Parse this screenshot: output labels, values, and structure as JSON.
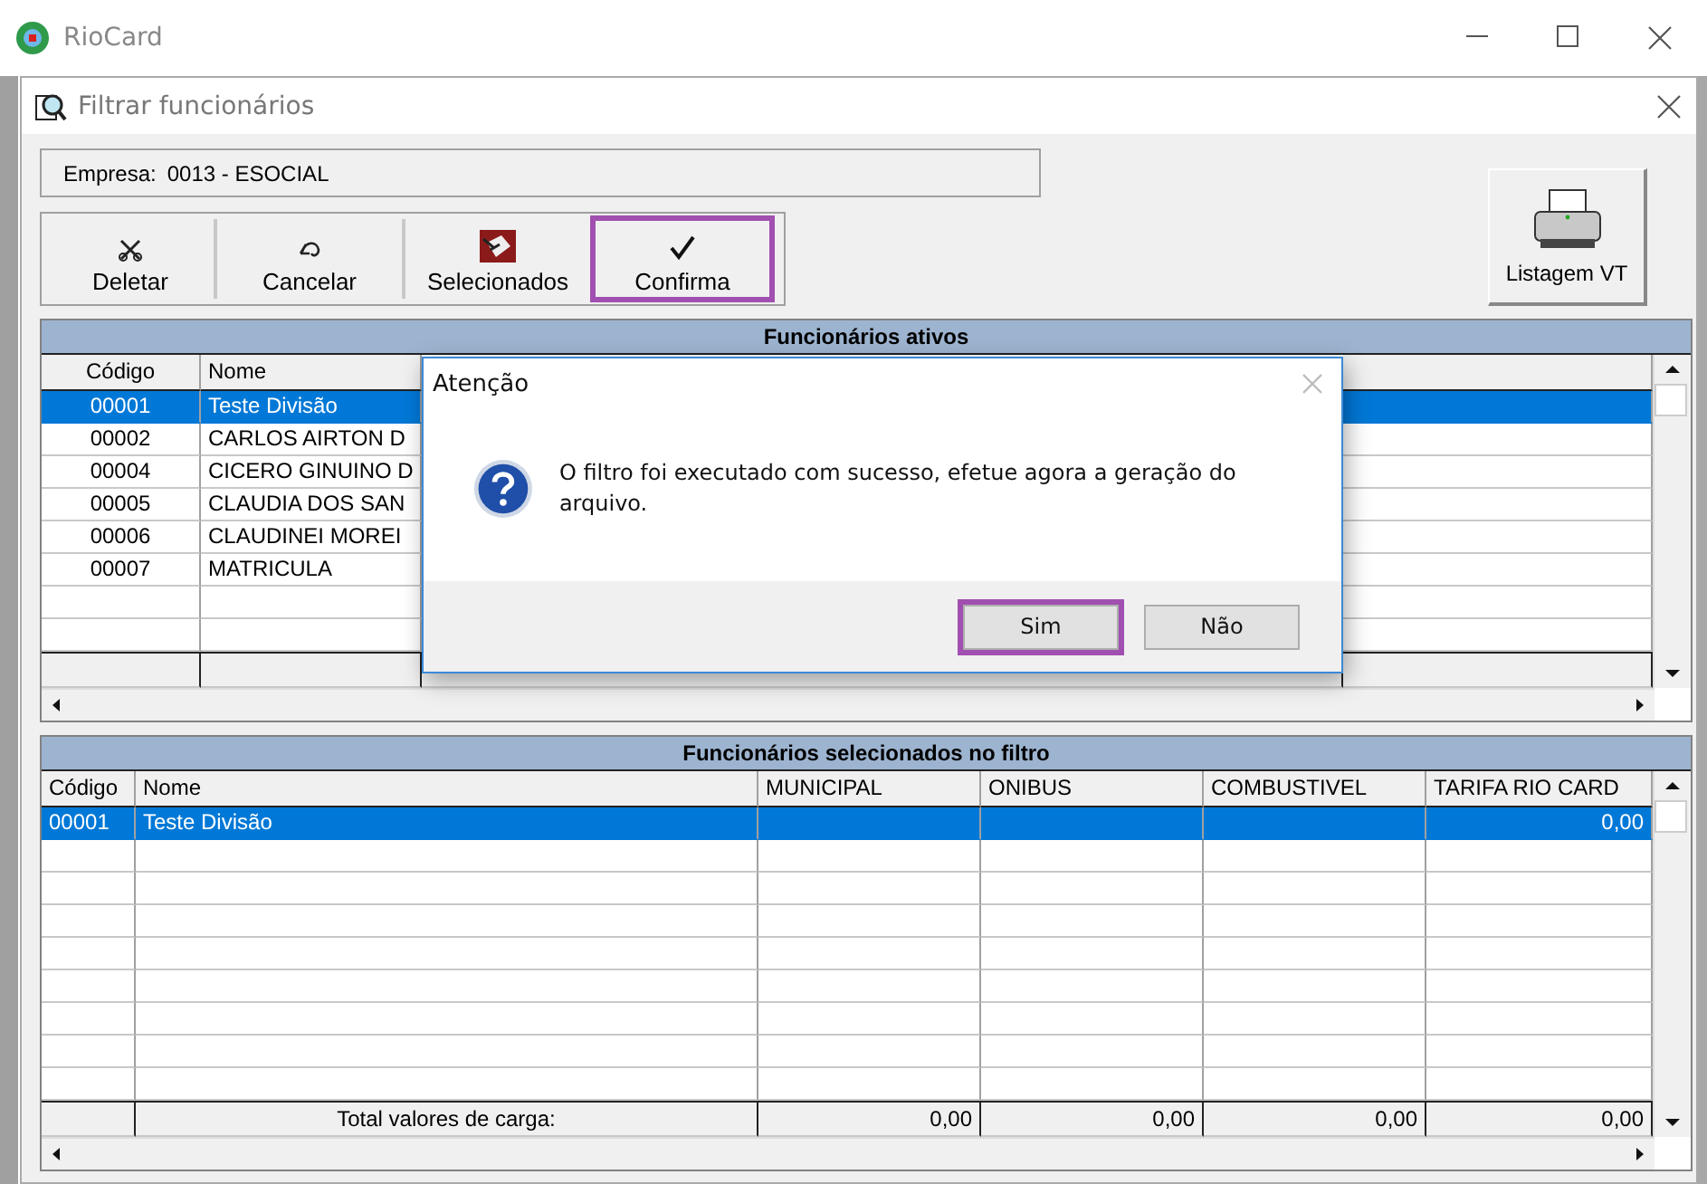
{
  "app_window": {
    "title": "RioCard"
  },
  "filter_window": {
    "title": "Filtrar funcionários"
  },
  "company": {
    "label": "Empresa:",
    "value": "0013 - ESOCIAL"
  },
  "toolbar": [
    {
      "kind": "delete",
      "label": "Deletar",
      "highlighted": false
    },
    {
      "kind": "cancel",
      "label": "Cancelar",
      "highlighted": false
    },
    {
      "kind": "selected",
      "label": "Selecionados",
      "highlighted": false
    },
    {
      "kind": "confirm",
      "label": "Confirma",
      "highlighted": true
    }
  ],
  "report_button": {
    "label": "Listagem VT"
  },
  "active_grid": {
    "title": "Funcionários ativos",
    "columns": [
      "Código",
      "Nome"
    ],
    "rows": [
      {
        "code": "00001",
        "name": "Teste Divisão",
        "selected": true
      },
      {
        "code": "00002",
        "name": "CARLOS AIRTON D",
        "selected": false
      },
      {
        "code": "00004",
        "name": "CICERO GINUINO D",
        "selected": false
      },
      {
        "code": "00005",
        "name": "CLAUDIA DOS SAN",
        "selected": false
      },
      {
        "code": "00006",
        "name": "CLAUDINEI MOREI",
        "selected": false
      },
      {
        "code": "00007",
        "name": "MATRICULA",
        "selected": false
      }
    ]
  },
  "selected_grid": {
    "title": "Funcionários selecionados no filtro",
    "columns": [
      "Código",
      "Nome",
      "MUNICIPAL",
      "ONIBUS",
      "COMBUSTIVEL",
      "TARIFA RIO CARD"
    ],
    "rows": [
      {
        "code": "00001",
        "name": "Teste Divisão",
        "tarifa_rio_card": "0,00",
        "selected": true
      }
    ],
    "totals": {
      "label": "Total valores de carga:",
      "values": [
        "0,00",
        "0,00",
        "0,00",
        "0,00"
      ]
    }
  },
  "dialog": {
    "title": "Atenção",
    "message": "O filtro foi executado com sucesso, efetue agora a geração do arquivo.",
    "buttons": [
      {
        "label": "Sim",
        "highlighted": true
      },
      {
        "label": "Não",
        "highlighted": false
      }
    ]
  }
}
